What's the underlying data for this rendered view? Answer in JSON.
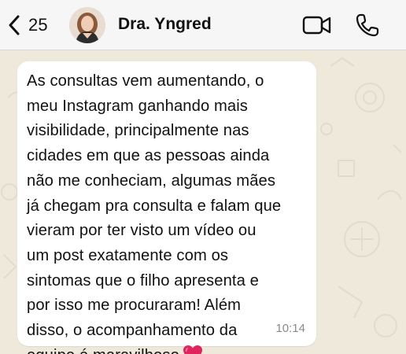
{
  "header": {
    "back_count": "25",
    "contact_name": "Dra. Yngred"
  },
  "icons": {
    "back": "chevron-left-icon",
    "video": "video-call-icon",
    "call": "phone-icon",
    "heart": "red-heart-icon"
  },
  "message": {
    "text": "As consultas vem aumentando, o\nmeu Instagram ganhando mais\nvisibilidade, principalmente nas\ncidades em que as pessoas ainda\nnão me conheciam, algumas mães\njá chegam pra consulta e falam que\nvieram por ter visto um vídeo ou\num post exatamente com os\nsintomas que o filho apresenta e\npor isso me procuraram! Além\ndisso, o acompanhamento da\nequipe é maravilhoso",
    "time": "10:14"
  },
  "colors": {
    "header_bg": "#f6f6f6",
    "chat_bg": "#efe9dc",
    "bubble_bg": "#ffffff",
    "heart": "#e0245e",
    "time_text": "#8a8a8a"
  }
}
